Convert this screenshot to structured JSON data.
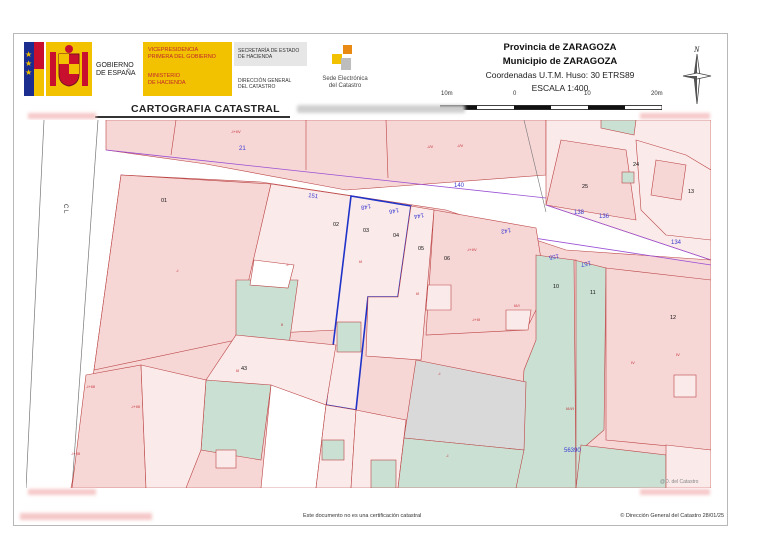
{
  "header": {
    "gobierno_label": [
      "GOBIERNO",
      "DE ESPAÑA"
    ],
    "vicepresidencia": [
      "VICEPRESIDENCIA",
      "PRIMERA DEL GOBIERNO"
    ],
    "ministerio": [
      "MINISTERIO",
      "DE HACIENDA"
    ],
    "secretaria": [
      "SECRETARÍA DE ESTADO",
      "DE HACIENDA"
    ],
    "direccion": [
      "DIRECCIÓN GENERAL",
      "DEL CATASTRO"
    ],
    "sede": [
      "Sede Electrónica",
      "del Catastro"
    ],
    "province": "Provincia de ZARAGOZA",
    "municipality": "Municipio de ZARAGOZA",
    "coords": "Coordenadas U.T.M. Huso: 30 ETRS89",
    "scale": "ESCALA 1:400",
    "scale_ticks": [
      "10m",
      "0",
      "10",
      "20m"
    ],
    "north": "N",
    "title": "CARTOGRAFIA CATASTRAL"
  },
  "footer": {
    "disclaimer": "Este documento no es una certificación catastral",
    "copyright": "© Dirección General del Catastro 28/01/25"
  },
  "map": {
    "block_labels": [
      "01",
      "02",
      "03",
      "04",
      "05",
      "06",
      "10",
      "11",
      "12",
      "13",
      "24",
      "25",
      "43"
    ],
    "street_numbers": [
      "21",
      "140",
      "151",
      "148",
      "146",
      "144",
      "142",
      "155",
      "157",
      "138",
      "136",
      "134"
    ],
    "street_label": "C L",
    "parcel_ref": "56390",
    "corner_mark": "@D. del Catastro"
  },
  "colors": {
    "parcel_pink": "#f7d6d6",
    "parcel_light": "#fbeaea",
    "parcel_green": "#c9e0d3",
    "parcel_grey": "#d9d9d9",
    "selected_outline": "#1f33c9",
    "street_line": "#9a4fd4",
    "title_red": "#c0282d"
  }
}
